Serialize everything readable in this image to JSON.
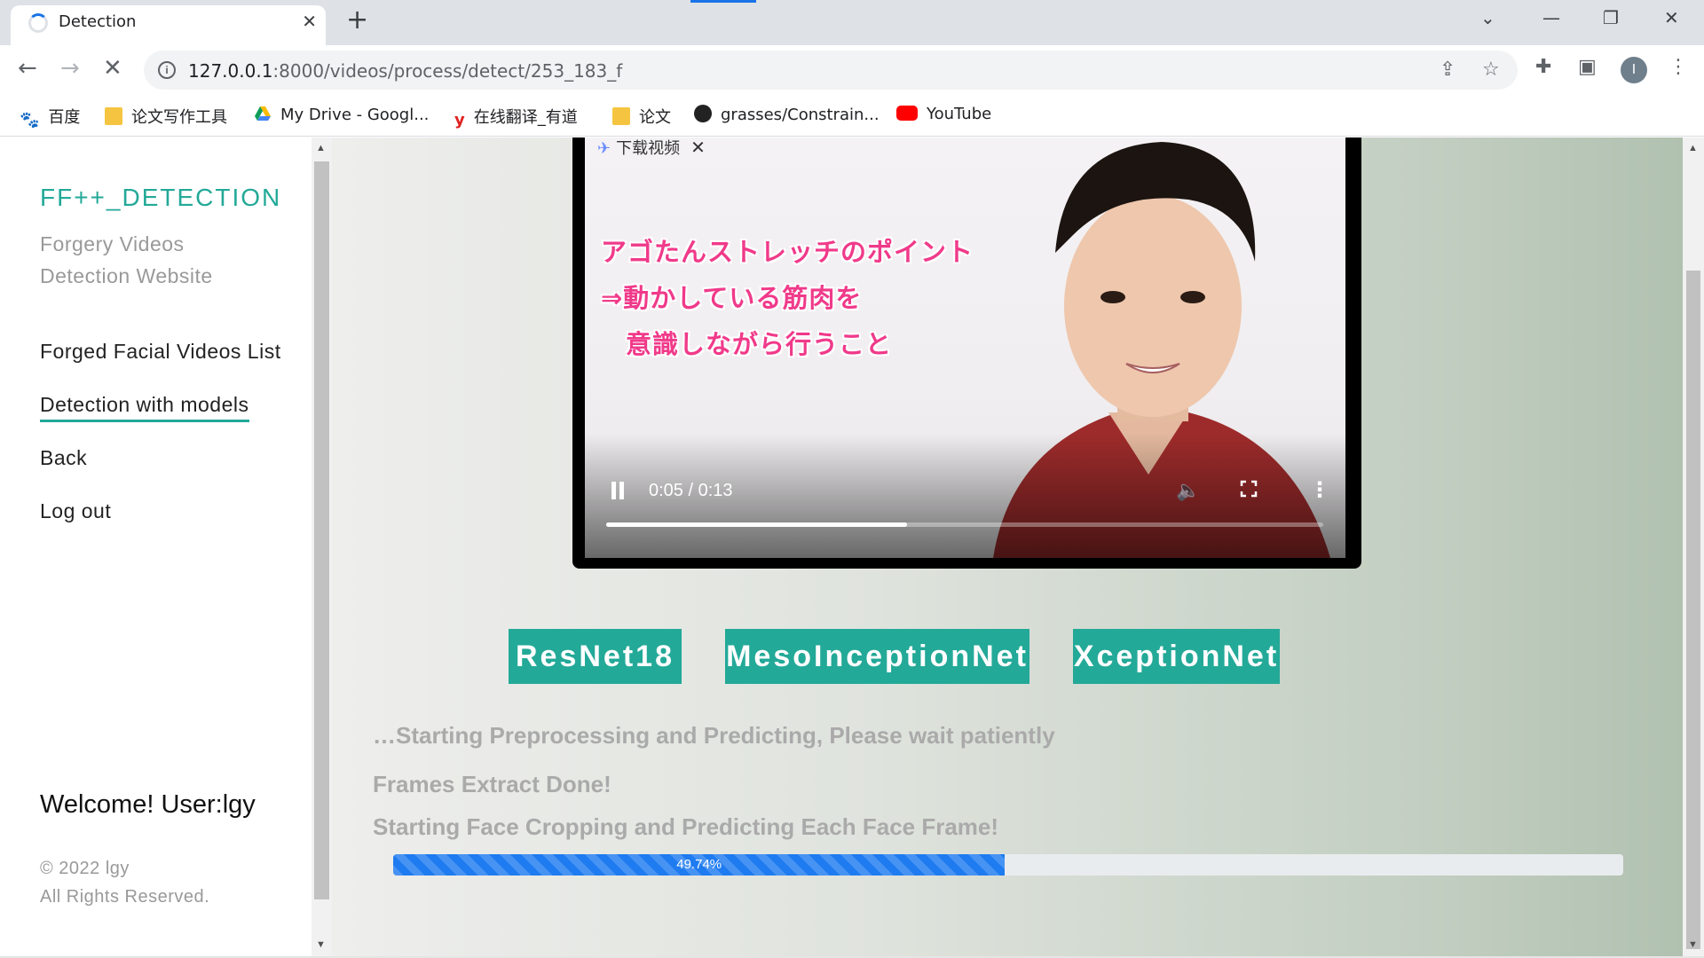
{
  "browser": {
    "tab_title": "Detection",
    "tab_close": "✕",
    "new_tab": "+",
    "url_host": "127.0.0.1",
    "url_path": ":8000/videos/process/detect/253_183_f",
    "avatar_letter": "I",
    "bookmarks": [
      {
        "label": "百度",
        "icon": "baidu-icon"
      },
      {
        "label": "论文写作工具",
        "icon": "folder-icon"
      },
      {
        "label": "My Drive - Googl...",
        "icon": "google-drive-icon"
      },
      {
        "label": "在线翻译_有道",
        "icon": "youdao-icon"
      },
      {
        "label": "论文",
        "icon": "folder-icon"
      },
      {
        "label": "grasses/Constrain...",
        "icon": "github-icon"
      },
      {
        "label": "YouTube",
        "icon": "youtube-icon"
      }
    ]
  },
  "sidebar": {
    "brand": "FF++_DETECTION",
    "tagline_1": "Forgery Videos",
    "tagline_2": "Detection Website",
    "nav": [
      {
        "label": "Forged Facial Videos List",
        "active": false
      },
      {
        "label": "Detection with models",
        "active": true
      },
      {
        "label": "Back",
        "active": false
      },
      {
        "label": "Log out",
        "active": false
      }
    ],
    "welcome": "Welcome! User:lgy",
    "copyright_1": "© 2022 lgy",
    "copyright_2": "All Rights Reserved."
  },
  "video": {
    "overlay_label": "下载视频",
    "caption_lines": [
      "アゴたんストレッチのポイント",
      "⇒動かしている筋肉を",
      "意識しながら行うこと"
    ],
    "time": "0:05 / 0:13",
    "played_fraction": 0.42
  },
  "models": [
    "ResNet18",
    "MesoInceptionNet",
    "XceptionNet"
  ],
  "status": {
    "line1": "…Starting Preprocessing and Predicting, Please wait patiently",
    "line2": "Frames Extract Done!",
    "line3": "Starting Face Cropping and Predicting Each Face Frame!"
  },
  "progress": {
    "value": 49.74,
    "label": "49.74%"
  },
  "colors": {
    "accent": "#23a998",
    "progress": "#1e7bf0"
  }
}
